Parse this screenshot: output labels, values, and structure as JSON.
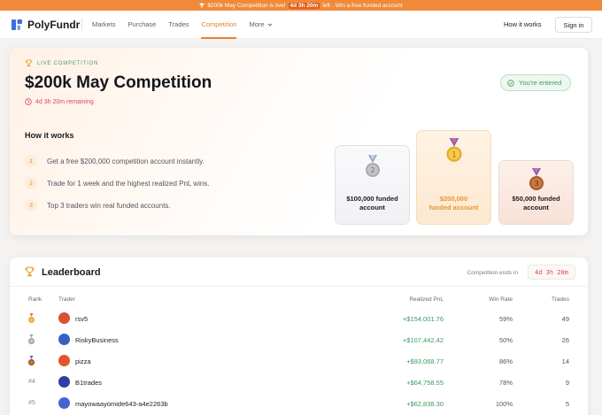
{
  "banner": {
    "prefix": "$200k May Competition is live!",
    "countdown": "4d 3h 20m",
    "suffix": "left · Win a free funded account"
  },
  "nav": {
    "brand": "PolyFundr",
    "links": [
      "Markets",
      "Purchase",
      "Trades",
      "Competition"
    ],
    "more": "More",
    "how_it_works": "How it works",
    "sign_in": "Sign in"
  },
  "competition": {
    "tag": "LIVE COMPETITION",
    "title": "$200k May Competition",
    "remaining": "4d 3h 20m remaining",
    "entered": "You're entered",
    "how_title": "How it works",
    "steps": [
      {
        "num": "1",
        "text": "Get a free $200,000 competition account instantly."
      },
      {
        "num": "2",
        "text": "Trade for 1 week and the highest realized PnL wins."
      },
      {
        "num": "3",
        "text": "Top 3 traders win real funded accounts."
      }
    ],
    "prizes": [
      {
        "place": "2",
        "line1": "$100,000 funded",
        "line2": "account"
      },
      {
        "place": "1",
        "line1": "$200,000",
        "line2": "funded account"
      },
      {
        "place": "3",
        "line1": "$50,000 funded",
        "line2": "account"
      }
    ]
  },
  "leaderboard": {
    "title": "Leaderboard",
    "ends_label": "Competition ends in",
    "ends_timer": "4d 3h 20m",
    "columns": {
      "rank": "Rank",
      "trader": "Trader",
      "pnl": "Realized PnL",
      "winrate": "Win Rate",
      "trades": "Trades"
    },
    "rows": [
      {
        "rank": "",
        "medal": "gold",
        "name": "rsv5",
        "pnl": "+$154,001.76",
        "winrate": "59%",
        "trades": "49",
        "avatar_color": "#d9512f"
      },
      {
        "rank": "",
        "medal": "silver",
        "name": "RiskyBusiness",
        "pnl": "+$107,442.42",
        "winrate": "50%",
        "trades": "26",
        "avatar_color": "#3a5fc4"
      },
      {
        "rank": "",
        "medal": "bronze",
        "name": "pizza",
        "pnl": "+$93,068.77",
        "winrate": "86%",
        "trades": "14",
        "avatar_color": "#e2542c"
      },
      {
        "rank": "#4",
        "medal": "",
        "name": "B1trades",
        "pnl": "+$64,758.55",
        "winrate": "78%",
        "trades": "9",
        "avatar_color": "#2e3fa6"
      },
      {
        "rank": "#5",
        "medal": "",
        "name": "mayowaayomide643-a4e2263b",
        "pnl": "+$62,838.30",
        "winrate": "100%",
        "trades": "5",
        "avatar_color": "#4a62d0"
      }
    ]
  },
  "colors": {
    "accent": "#e8832f",
    "green": "#3a9a62",
    "red": "#e0455b"
  }
}
